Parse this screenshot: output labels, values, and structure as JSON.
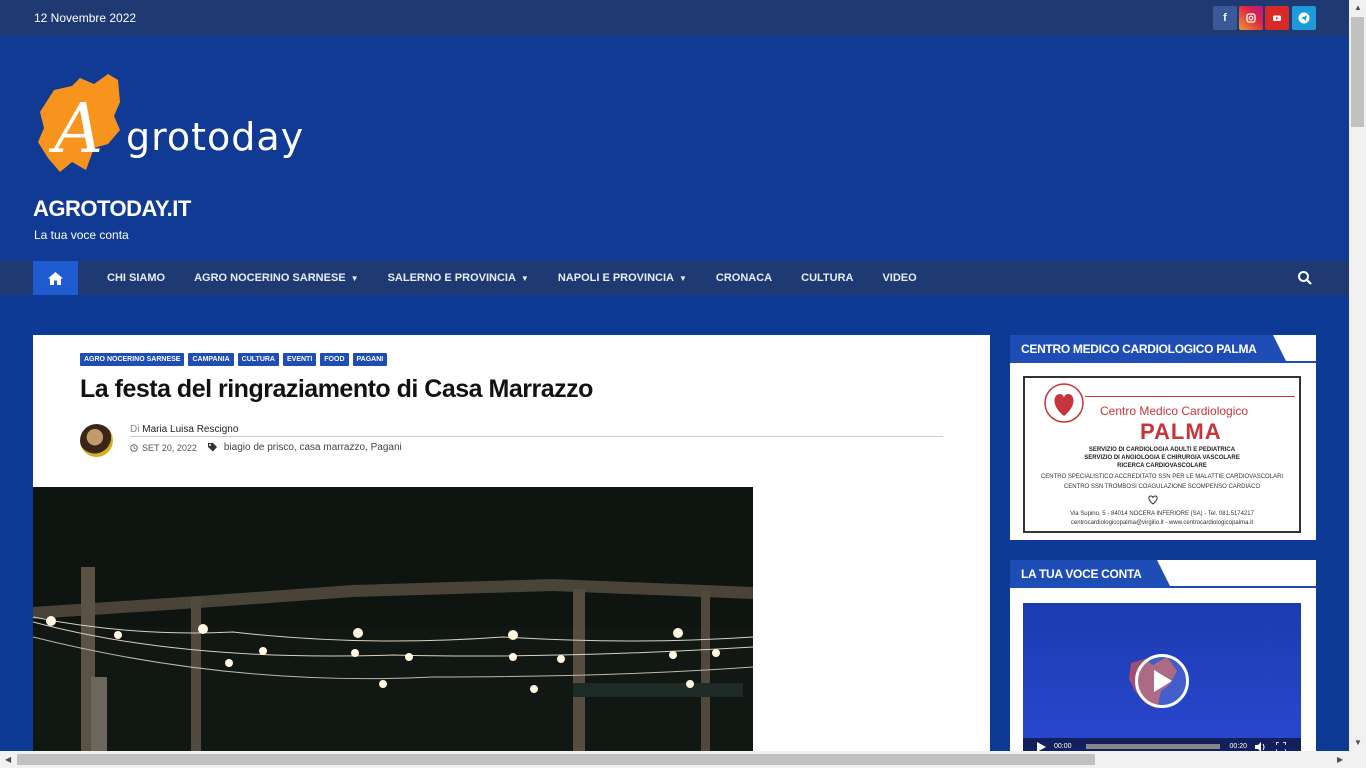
{
  "topbar": {
    "date": "12 Novembre 2022",
    "social_icons": [
      "facebook-icon",
      "instagram-icon",
      "youtube-icon",
      "telegram-icon"
    ]
  },
  "site": {
    "logo_text": "Agrotoday",
    "title": "AGROTODAY.IT",
    "tagline": "La tua voce conta"
  },
  "nav": {
    "items": [
      {
        "label": "CHI SIAMO",
        "dropdown": false
      },
      {
        "label": "AGRO NOCERINO SARNESE",
        "dropdown": true
      },
      {
        "label": "SALERNO E PROVINCIA",
        "dropdown": true
      },
      {
        "label": "NAPOLI E PROVINCIA",
        "dropdown": true
      },
      {
        "label": "CRONACA",
        "dropdown": false
      },
      {
        "label": "CULTURA",
        "dropdown": false
      },
      {
        "label": "VIDEO",
        "dropdown": false
      }
    ]
  },
  "article": {
    "categories": [
      "AGRO NOCERINO SARNESE",
      "CAMPANIA",
      "CULTURA",
      "EVENTI",
      "FOOD",
      "PAGANI"
    ],
    "title": "La festa del ringraziamento di Casa Marrazzo",
    "by_prefix": "Di",
    "author": "Maria Luisa Rescigno",
    "date": "SET 20, 2022",
    "tags": "biagio de prisco, casa marrazzo, Pagani"
  },
  "sidebar": {
    "widget1": {
      "title": "CENTRO MEDICO CARDIOLOGICO PALMA",
      "ad": {
        "name": "Centro Medico Cardiologico",
        "brand": "PALMA",
        "lines": [
          "SERVIZIO DI CARDIOLOGIA ADULTI E PEDIATRICA",
          "SERVIZIO DI ANGIOLOGIA E CHIRURGIA VASCOLARE",
          "RICERCA CARDIOVASCOLARE"
        ],
        "lines2": [
          "CENTRO SPECIALISTICO ACCREDITATO SSN PER LE MALATTIE CARDIOVASCOLARI",
          "CENTRO SSN TROMBOSI COAGULAZIONE SCOMPENSO CARDIACO"
        ],
        "address": "Via Supino, 5 - 84014 NOCERA INFERIORE (SA) - Tel. 081.5174217",
        "contacts": "centrocardiologicopalma@virgilio.it - www.centrocardiologicopalma.it"
      }
    },
    "widget2": {
      "title": "LA TUA VOCE CONTA",
      "video": {
        "current": "00:00",
        "duration": "00:20"
      }
    }
  },
  "colors": {
    "header_bg": "#103a93",
    "nav_bg": "#1f3a73",
    "accent": "#1d4db5",
    "logo_orange": "#f7941d"
  }
}
